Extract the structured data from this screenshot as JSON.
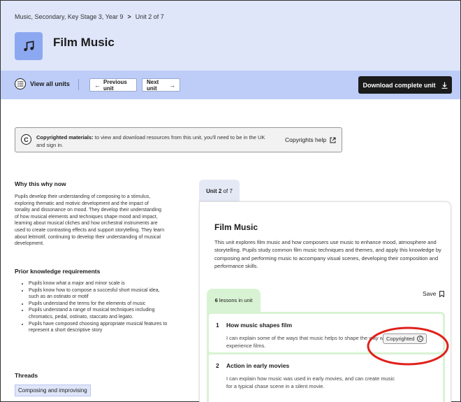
{
  "breadcrumb": {
    "path": "Music, Secondary, Key Stage 3, Year 9",
    "sep": ">",
    "current": "Unit 2 of 7"
  },
  "header": {
    "title": "Film Music",
    "icon": "music-note-icon"
  },
  "nav": {
    "view_all": "View all units",
    "prev": "Previous unit",
    "next": "Next unit",
    "download": "Download complete unit"
  },
  "copyright_banner": {
    "strong": "Copyrighted materials:",
    "text": " to view and download resources from this unit, you'll need to be in the UK and sign in.",
    "help": "Copyrights help",
    "c_glyph": "C"
  },
  "why": {
    "heading": "Why this why now",
    "body": "Pupils develop their understanding of composing to a stimulus, exploring thematic and motivic development and the impact of tonality and dissonance on mood. They develop their understanding of how musical elements and techniques shape mood and impact, learning about musical cliches and how orchestral instruments are used to create contrasting effects and support storytelling. They learn about leitmotif, continuing to develop their understanding of musical development."
  },
  "prior": {
    "heading": "Prior knowledge requirements",
    "items": [
      "Pupils know what a major and minor scale is",
      "Pupils know how to compose a succesful short musical idea, such as an ostinato or motif",
      "Pupils understand the terms for the elements of music",
      "Pupils understand a range of musical techniques including chromatics, pedal, ostinato, staccato and legato.",
      "Pupils have composed choosing appropriate musical features to represent a short descriptive story"
    ]
  },
  "threads": {
    "heading": "Threads",
    "tag": "Composing and improvising"
  },
  "unit_tab": {
    "prefix": "Unit ",
    "num": "2",
    "suffix": " of 7"
  },
  "unit_card": {
    "title": "Film Music",
    "description": "This unit explores film music and how composers use music to enhance mood, atmosphere and storytelling. Pupils study common film music techniques and themes, and apply this knowledge by composing and performing music to accompany visual scenes, developing their composition and performance skills.",
    "lessons_count": "6",
    "lessons_label": " lessons in unit",
    "save": "Save"
  },
  "lessons": [
    {
      "num": "1",
      "title": "How music shapes film",
      "desc": "I can explain some of the ways that music helps to shape the way we experience films.",
      "badge": "Copyrighted"
    },
    {
      "num": "2",
      "title": "Action in early movies",
      "desc": "I can explain how music was used in early movies, and can create music for a typical chase scene in a silent movie."
    }
  ],
  "colors": {
    "hero": "#dfe6fa",
    "navbar": "#bdcdf8",
    "tile": "#8ca8f0",
    "lessons_green": "#d8f3d3",
    "annotation": "#e0201b"
  }
}
